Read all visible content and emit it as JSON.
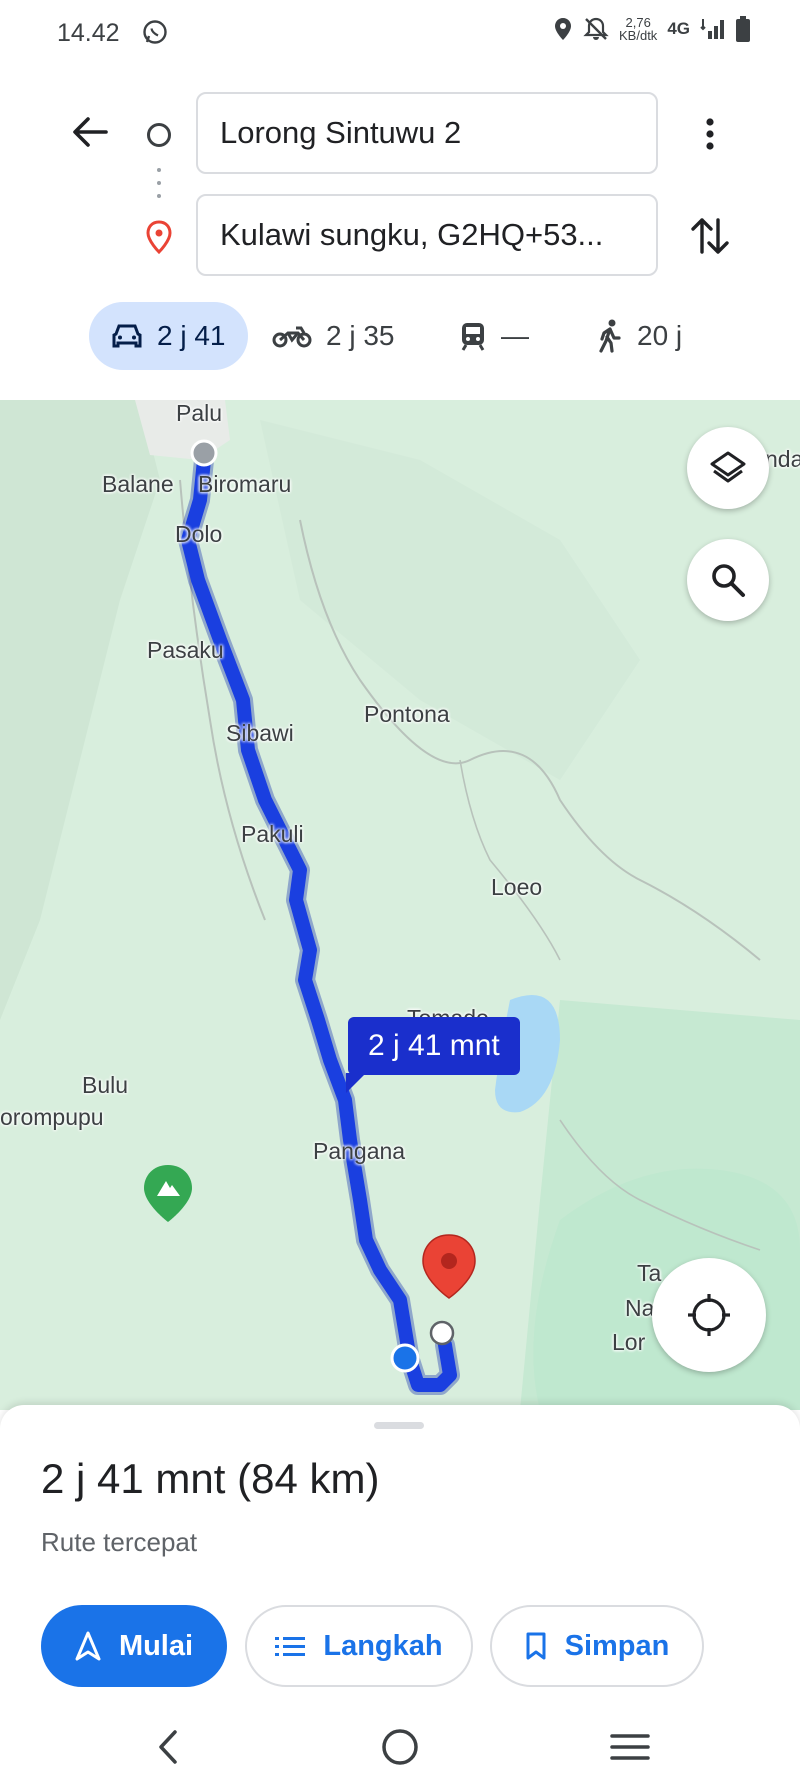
{
  "status_bar": {
    "time": "14.42",
    "net_speed_value": "2,76",
    "net_speed_unit": "KB/dtk",
    "network": "4G"
  },
  "directions": {
    "origin": "Lorong Sintuwu 2",
    "destination": "Kulawi sungku, G2HQ+53..."
  },
  "modes": [
    {
      "icon": "car-icon",
      "label": "2 j 41",
      "active": true
    },
    {
      "icon": "motorcycle-icon",
      "label": "2 j 35",
      "active": false
    },
    {
      "icon": "transit-icon",
      "label": "—",
      "active": false
    },
    {
      "icon": "walk-icon",
      "label": "20 j",
      "active": false
    }
  ],
  "map": {
    "places": [
      "Palu",
      "Balane",
      "Biromaru",
      "Dolo",
      "Pasaku",
      "Sibawi",
      "Pontona",
      "Pakuli",
      "Loeo",
      "Tomado",
      "Bulu",
      "orompupu",
      "Pangana",
      "Ta",
      "Na",
      "Lor",
      "nda"
    ],
    "route_time_label": "2 j 41 mnt",
    "colors": {
      "route": "#1a3fe0",
      "land": "#d8eedd",
      "park": "#bfe8cf",
      "water": "#a9d8f5",
      "pin": "#ea4335"
    }
  },
  "route_summary": {
    "title": "2 j 41 mnt (84 km)",
    "subtitle": "Rute tercepat"
  },
  "actions": {
    "start_label": "Mulai",
    "steps_label": "Langkah",
    "save_label": "Simpan"
  }
}
